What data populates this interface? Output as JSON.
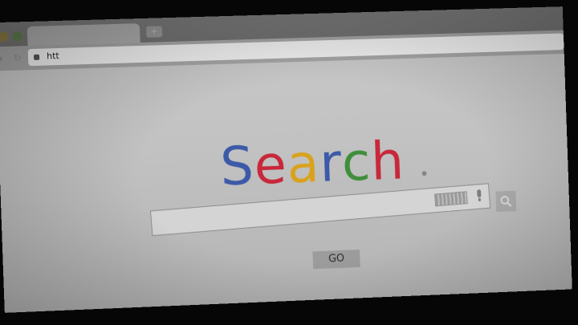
{
  "browser": {
    "url_text": "htt",
    "new_tab_symbol": "+",
    "back_symbol": "◂",
    "reload_symbol": "↻"
  },
  "page": {
    "logo": {
      "letters": [
        "S",
        "e",
        "a",
        "r",
        "c",
        "h"
      ],
      "colors": [
        "#3d5aa8",
        "#c8283a",
        "#d9a21c",
        "#3d5aa8",
        "#3f8e3b",
        "#c8283a"
      ]
    },
    "search_input": {
      "value": "",
      "placeholder": ""
    },
    "go_label": "GO"
  },
  "icons": {
    "close": "window-close-icon",
    "minimize": "window-minimize-icon",
    "lock": "lock-icon",
    "keyboard": "keyboard-icon",
    "mic": "microphone-icon",
    "search": "magnifier-icon"
  }
}
